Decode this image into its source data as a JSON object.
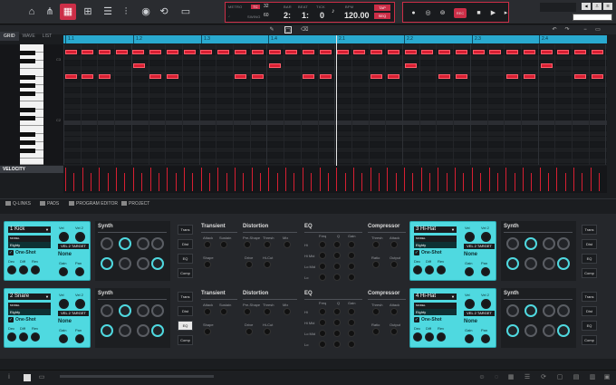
{
  "toolbar": {
    "icons": [
      "home-icon",
      "tree-icon",
      "grid-view-icon",
      "plus-box-icon",
      "mixer-icon",
      "sliders-icon",
      "record-icon",
      "loop-icon",
      "folder-icon"
    ]
  },
  "transport": {
    "metro_label": "METRO",
    "tc_label": "TC",
    "tc_value": "32",
    "swing_label": "SWING",
    "swing_value": "60",
    "bar_label": "BAR",
    "beat_label": "BEAT",
    "tick_label": "TICK",
    "bar_value": "2:",
    "beat_value": "1:",
    "tick_value": "0",
    "bpm_label": "BPM",
    "bpm_value": "120.00",
    "tap_label": "TAP",
    "seq_label": "SEQ",
    "rec_label": "REC",
    "od_label": "OD"
  },
  "view_tabs": [
    "GRID",
    "WAVE",
    "LIST"
  ],
  "ruler_marks": [
    "1.1",
    "1.2",
    "1.3",
    "1.4",
    "2.1",
    "2.2",
    "2.3",
    "2.4"
  ],
  "key_labels": [
    "C3",
    "C2"
  ],
  "velocity_label": "VELOCITY",
  "lower_tabs": [
    "Q-LINKS",
    "PADS",
    "PROGRAM EDITOR",
    "PROJECT"
  ],
  "pads": [
    {
      "index": "1",
      "name": "Kick",
      "model_label": "MODEL",
      "model": "Eighty",
      "one_shot": "One-Shot",
      "velo_target": "VEL 2 TARGET",
      "velo_value": "None",
      "vel1": "Vel",
      "vel2": "Vel 2",
      "dec": "Dec",
      "diff": "Diff",
      "rev": "Rev",
      "gain": "Gain",
      "pan": "Pan"
    },
    {
      "index": "2",
      "name": "Snare",
      "model_label": "MODEL",
      "model": "Eighty",
      "one_shot": "One-Shot",
      "velo_target": "VEL 2 TARGET",
      "velo_value": "None",
      "vel1": "Vel",
      "vel2": "Vel 2",
      "dec": "Dec",
      "diff": "Diff",
      "rev": "Rev",
      "gain": "Gain",
      "pan": "Pan"
    },
    {
      "index": "3",
      "name": "Hi-Hat",
      "model_label": "MODEL",
      "model": "Eighty",
      "one_shot": "One-Shot",
      "velo_target": "VEL 2 TARGET",
      "velo_value": "None",
      "vel1": "Vel",
      "vel2": "Vel 2",
      "dec": "Dec",
      "diff": "Diff",
      "rev": "Rev",
      "gain": "Gain",
      "pan": "Pan"
    },
    {
      "index": "4",
      "name": "Hi-Hat",
      "model_label": "MODEL",
      "model": "Eighty",
      "one_shot": "One-Shot",
      "velo_target": "VEL 2 TARGET",
      "velo_value": "None",
      "vel1": "Vel",
      "vel2": "Vel 2",
      "dec": "Dec",
      "diff": "Diff",
      "rev": "Rev",
      "gain": "Gain",
      "pan": "Pan"
    }
  ],
  "synth_title": "Synth",
  "fx_buttons": [
    "Trans",
    "Dist",
    "EQ",
    "Comp"
  ],
  "sections": {
    "transient": "Transient",
    "distortion": "Distortion",
    "eq": "EQ",
    "compressor": "Compressor",
    "attack": "Attack",
    "sustain": "Sustain",
    "shape": "Shape",
    "pre_shape": "Pre-Shape",
    "thresh": "Thresh",
    "mix": "Mix",
    "drive": "Drive",
    "hicut": "Hi-Cut",
    "freq": "Freq",
    "q": "Q",
    "gain": "Gain",
    "hi": "Hi",
    "himid": "Hi Mid",
    "lomid": "Lo Mid",
    "lo": "Lo",
    "ratio": "Ratio",
    "output": "Output"
  }
}
